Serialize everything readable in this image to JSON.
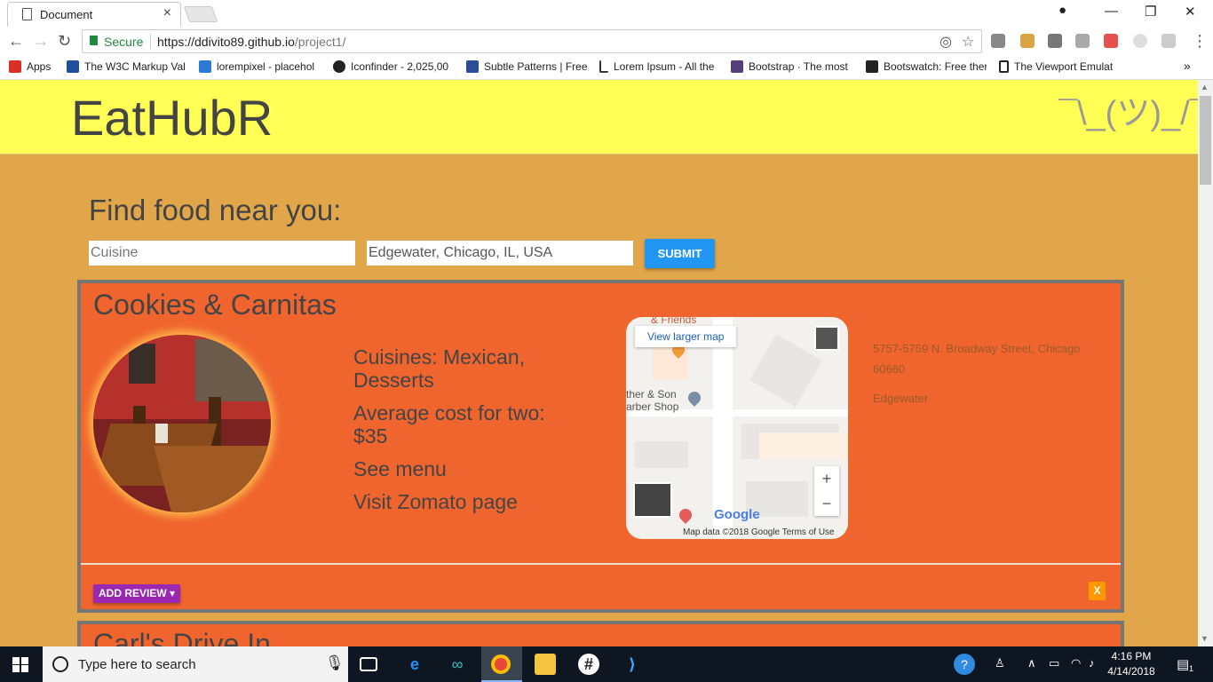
{
  "browser": {
    "tab_title": "Document",
    "tab_close": "×",
    "secure_label": "Secure",
    "url_host": "https://ddivito89.github.io",
    "url_path": "/project1/",
    "window_controls": [
      "—",
      "❐",
      "✕"
    ],
    "more_bookmarks": "»"
  },
  "bookmarks": [
    {
      "label": "Apps",
      "icon": "apps-grid-icon",
      "color": "#d93025"
    },
    {
      "label": "The W3C Markup Val",
      "icon": "w3c-icon",
      "color": "#1f4e9c"
    },
    {
      "label": "lorempixel - placehol",
      "icon": "lorempixel-icon",
      "color": "#2d7bd6"
    },
    {
      "label": "Iconfinder - 2,025,00",
      "icon": "iconfinder-icon",
      "color": "#222222"
    },
    {
      "label": "Subtle Patterns | Free",
      "icon": "subtle-patterns-icon",
      "color": "#2b4c9b"
    },
    {
      "label": "Lorem Ipsum - All the",
      "icon": "lorem-ipsum-icon",
      "color": "#333333"
    },
    {
      "label": "Bootstrap · The most",
      "icon": "bootstrap-icon",
      "color": "#563d7c"
    },
    {
      "label": "Bootswatch: Free ther",
      "icon": "bootswatch-icon",
      "color": "#222222"
    },
    {
      "label": "The Viewport Emulat",
      "icon": "viewport-emulator-icon",
      "color": "#222222"
    }
  ],
  "header": {
    "brand": "EatHubR",
    "shrug": "¯\\_(ツ)_/¯"
  },
  "search": {
    "title": "Find food near you:",
    "cuisine_placeholder": "Cuisine",
    "location_value": "Edgewater, Chicago, IL, USA",
    "submit_label": "SUBMIT"
  },
  "restaurants": [
    {
      "name": "Cookies & Carnitas",
      "cuisines": "Cuisines: Mexican, Desserts",
      "cost": "Average cost for two: $35",
      "menu_link": "See menu",
      "zomato_link": "Visit Zomato page",
      "address": "5757-5759 N. Broadway Street, Chicago 60660",
      "neighborhood": "Edgewater",
      "map": {
        "larger_map": "View larger map",
        "label_friends": "& Friends",
        "label_barber": "ther & Son\narber Shop",
        "zoom_in": "+",
        "zoom_out": "−",
        "google": "Google",
        "attribution": "Map data ©2018 Google    Terms of Use"
      },
      "add_review": "ADD REVIEW ▾",
      "close": "X"
    },
    {
      "name": "Carl's Drive In"
    }
  ],
  "taskbar": {
    "search_placeholder": "Type here to search",
    "time": "4:16 PM",
    "date": "4/14/2018",
    "notification_count": "1"
  },
  "colors": {
    "header_bg": "#ffff55",
    "page_bg": "#e2a64a",
    "card_bg": "#f0652e",
    "submit_bg": "#2196f3",
    "add_review_bg": "#9c27b0",
    "close_bg": "#ff9800"
  }
}
